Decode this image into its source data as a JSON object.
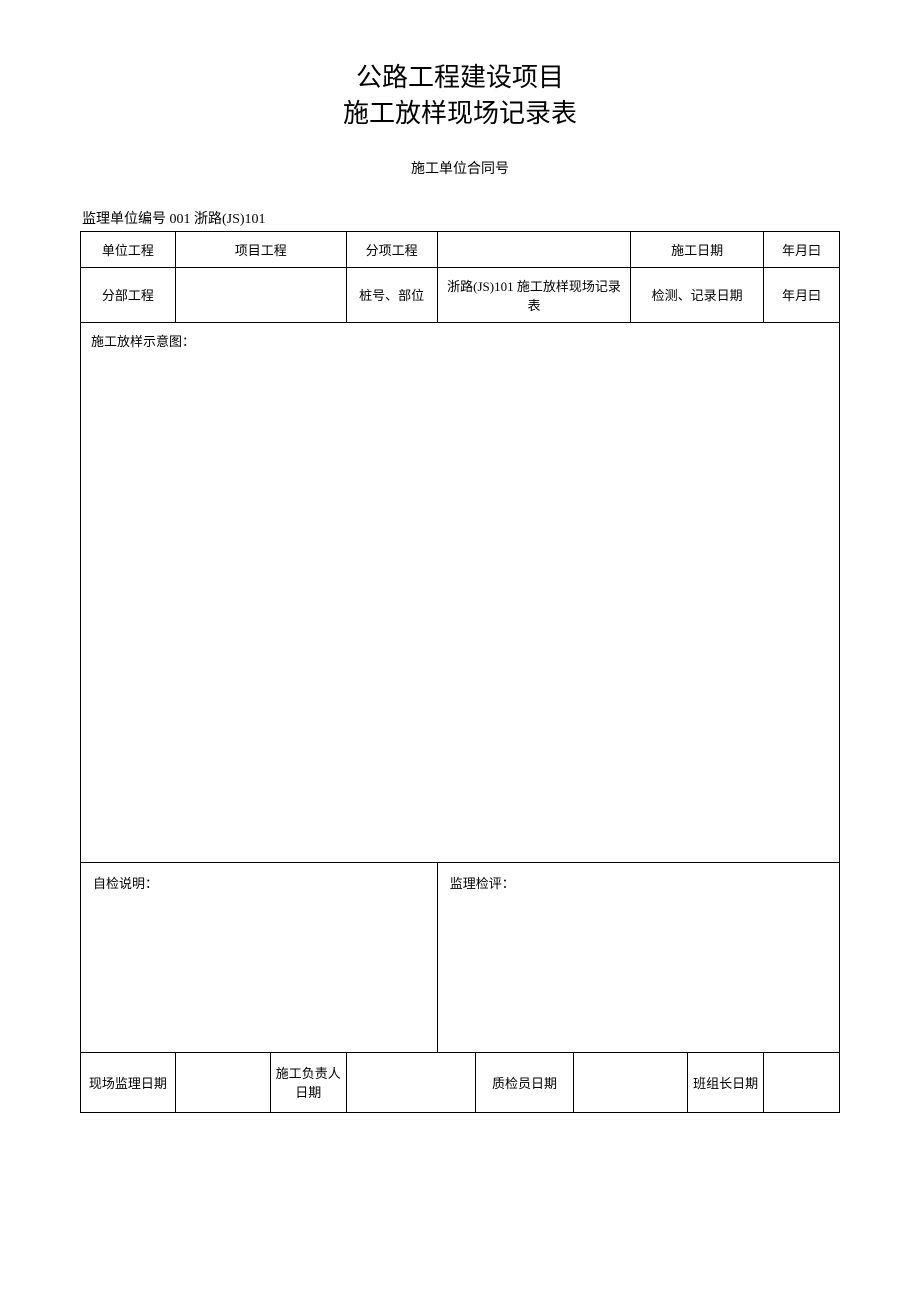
{
  "title": {
    "line1": "公路工程建设项目",
    "line2": "施工放样现场记录表"
  },
  "subtitle": "施工单位合同号",
  "preTableLine": "监理单位编号 001 浙路(JS)101",
  "headerRow1": {
    "c1": "单位工程",
    "c2": "项目工程",
    "c3": "分项工程",
    "c4": "",
    "c5": "施工日期",
    "c6": "年月曰"
  },
  "headerRow2": {
    "c1": "分部工程",
    "c2": "",
    "c3": "桩号、部位",
    "c4": "浙路(JS)101 施工放样现场记录表",
    "c5": "检测、记录日期",
    "c6": "年月曰"
  },
  "diagramLabel": "施工放样示意图：",
  "selfCheckLabel": "自检说明：",
  "supervisionLabel": "监理检评：",
  "signRow": {
    "c1": "现场监理日期",
    "c2": "",
    "c3": "施工负责人日期",
    "c4": "",
    "c5": "质检员日期",
    "c6": "",
    "c7": "班组长日期",
    "c8": ""
  }
}
